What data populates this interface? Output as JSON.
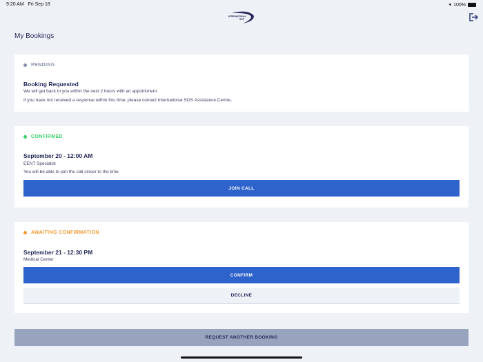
{
  "status_bar": {
    "time": "9:20 AM",
    "date": "Fri Sep 18",
    "battery": "100%"
  },
  "header": {
    "logo_text": "INTERNATIONAL SOS",
    "page_title": "My Bookings"
  },
  "bookings": [
    {
      "status": "PENDING",
      "status_color": "#8a90aa",
      "title": "Booking Requested",
      "lines": [
        "We will get back to you within the next 2 hours with an appointment.",
        "If you have not received a response within this time, please contact International SOS Assistance Centre."
      ]
    },
    {
      "status": "CONFIRMED",
      "status_color": "#3ccf6a",
      "title": "September 20 - 12:00 AM",
      "subtitle": "EENT Specialist",
      "note": "You will be able to join the call closer to the time",
      "button": "JOIN CALL"
    },
    {
      "status": "AWAITING CONFIRMATION",
      "status_color": "#f39a35",
      "title": "September 21 - 12:30 PM",
      "subtitle": "Medical Center",
      "confirm": "CONFIRM",
      "decline": "DECLINE"
    }
  ],
  "request_button": "REQUEST ANOTHER BOOKING"
}
